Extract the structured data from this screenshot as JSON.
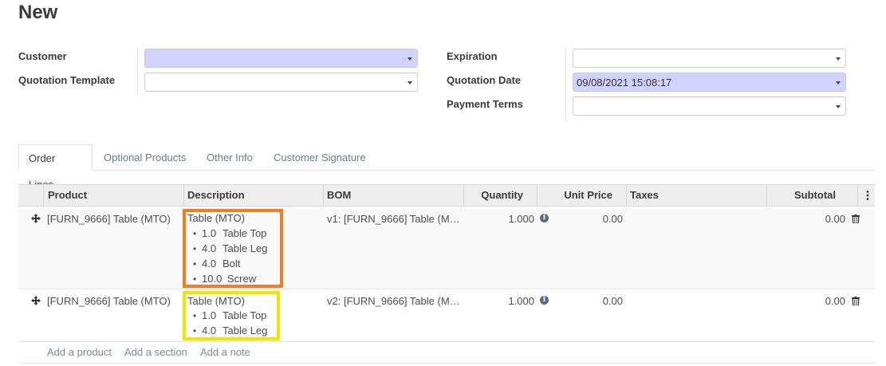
{
  "page": {
    "title": "New"
  },
  "form": {
    "customer": {
      "label": "Customer",
      "value": ""
    },
    "quotation_template": {
      "label": "Quotation Template",
      "value": ""
    },
    "expiration": {
      "label": "Expiration",
      "value": ""
    },
    "quotation_date": {
      "label": "Quotation Date",
      "value": "09/08/2021 15:08:17"
    },
    "payment_terms": {
      "label": "Payment Terms",
      "value": ""
    }
  },
  "tabs": [
    {
      "label": "Order Lines",
      "active": true
    },
    {
      "label": "Optional Products",
      "active": false
    },
    {
      "label": "Other Info",
      "active": false
    },
    {
      "label": "Customer Signature",
      "active": false
    }
  ],
  "table": {
    "headers": {
      "product": "Product",
      "description": "Description",
      "bom": "BOM",
      "quantity": "Quantity",
      "unit_price": "Unit Price",
      "taxes": "Taxes",
      "subtotal": "Subtotal"
    },
    "rows": [
      {
        "product": "[FURN_9666] Table (MTO)",
        "description_title": "Table (MTO)",
        "components": [
          {
            "qty": "1.0",
            "name": "Table Top"
          },
          {
            "qty": "4.0",
            "name": "Table Leg"
          },
          {
            "qty": "4.0",
            "name": "Bolt"
          },
          {
            "qty": "10.0",
            "name": "Screw"
          }
        ],
        "bom": "v1: [FURN_9666] Table (M…",
        "quantity": "1.000",
        "unit_price": "0.00",
        "taxes": "",
        "subtotal": "0.00",
        "highlight_color": "#f47d20"
      },
      {
        "product": "[FURN_9666] Table (MTO)",
        "description_title": "Table (MTO)",
        "components": [
          {
            "qty": "1.0",
            "name": "Table Top"
          },
          {
            "qty": "4.0",
            "name": "Table Leg"
          }
        ],
        "bom": "v2: [FURN_9666] Table (M…",
        "quantity": "1.000",
        "unit_price": "0.00",
        "taxes": "",
        "subtotal": "0.00",
        "highlight_color": "#f2e600"
      }
    ],
    "add_links": {
      "add_product": "Add a product",
      "add_section": "Add a section",
      "add_note": "Add a note"
    }
  },
  "icons": {
    "field_dropdown": "caret-down-icon",
    "row_handle": "move-handle-icon",
    "quantity_info": "info-icon",
    "row_delete": "trash-icon",
    "column_options": "vertical-ellipsis-icon"
  },
  "colors": {
    "required_field": "#d2d2ff",
    "header_bg": "#eeeeee",
    "link": "#7a8aa0"
  }
}
